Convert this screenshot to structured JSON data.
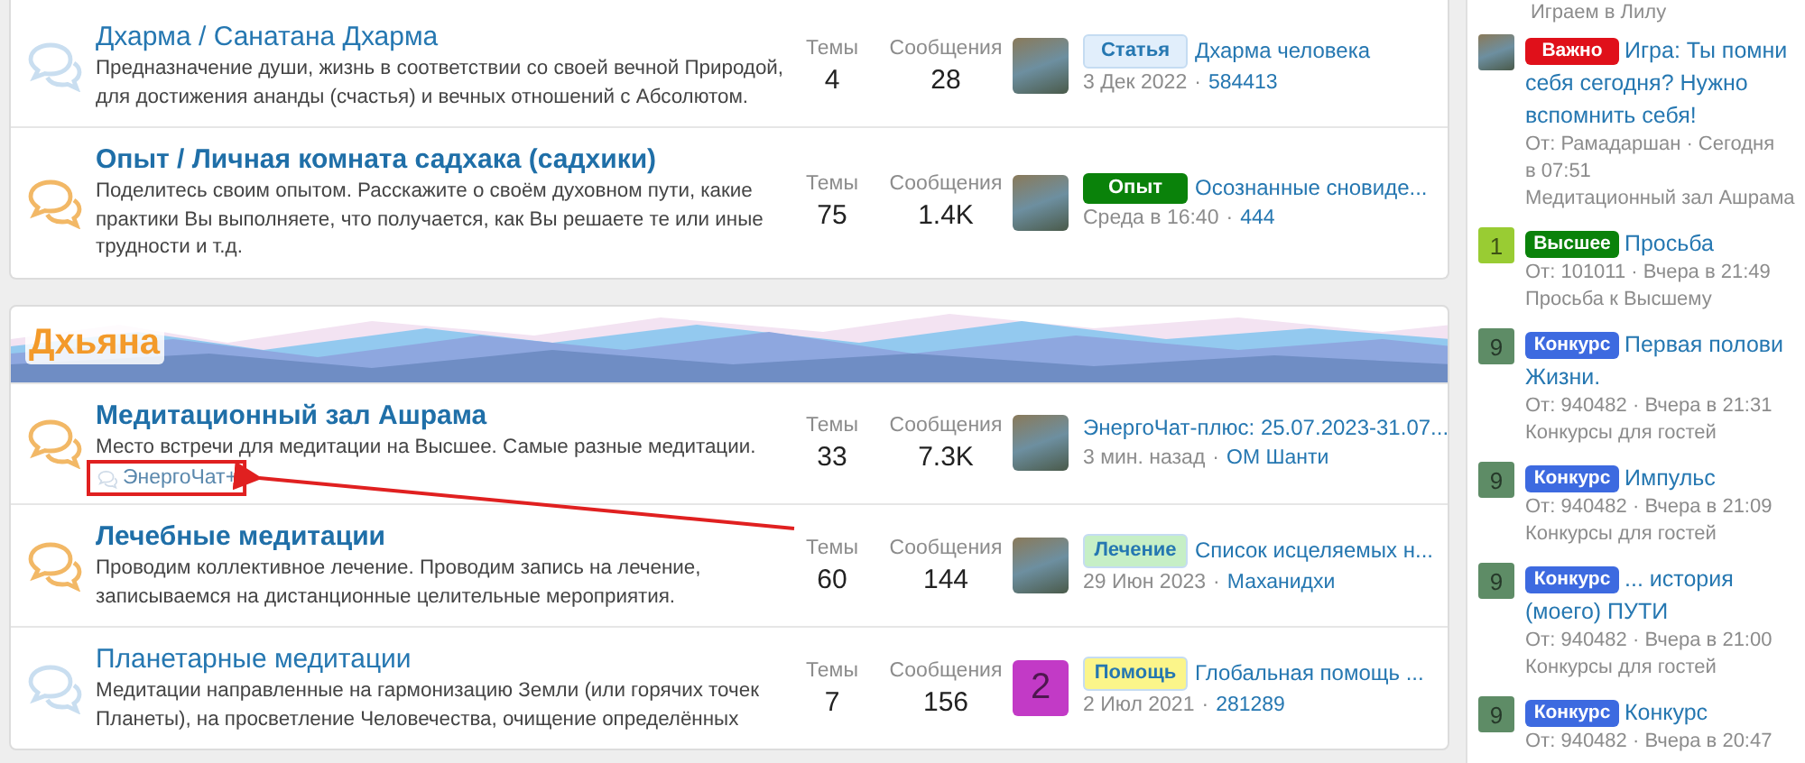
{
  "sections": [
    {
      "nodes": [
        {
          "title": "Дхарма / Санатана Дхарма",
          "unread": false,
          "description": "Предназначение души, жизнь в соответствии со своей вечной Природой, для достижения ананды (счастья) и вечных отношений с Абсолютом.",
          "stats": [
            {
              "label": "Темы",
              "value": "4"
            },
            {
              "label": "Сообщения",
              "value": "28"
            }
          ],
          "last_post": {
            "thumb": {
              "kind": "photo"
            },
            "prefix": {
              "label": "Статья",
              "color": "#e1eefb"
            },
            "title": "Дхарма человека",
            "date": "3 Дек 2022",
            "sep": "·",
            "user": "584413"
          }
        },
        {
          "title": "Опыт / Личная комната садхака (садхики)",
          "unread": true,
          "description": "Поделитесь своим опытом. Расскажите о своём духовном пути, какие практики Вы выполняете, что получается, как Вы решаете те или иные трудности и т.д.",
          "stats": [
            {
              "label": "Темы",
              "value": "75"
            },
            {
              "label": "Сообщения",
              "value": "1.4K"
            }
          ],
          "last_post": {
            "thumb": {
              "kind": "photo"
            },
            "prefix": {
              "label": "Опыт",
              "color": "#0a820a"
            },
            "title": "Осознанные сновиде...",
            "date": "Среда в 16:40",
            "sep": "·",
            "user": "444"
          }
        }
      ]
    },
    {
      "title": "Дхьяна",
      "nodes": [
        {
          "title": "Медитационный зал Ашрама",
          "unread": true,
          "description": "Место встречи для медитации на Высшее. Самые разные медитации.",
          "subforums": [
            {
              "title": "ЭнергоЧат+"
            }
          ],
          "stats": [
            {
              "label": "Темы",
              "value": "33"
            },
            {
              "label": "Сообщения",
              "value": "7.3K"
            }
          ],
          "last_post": {
            "thumb": {
              "kind": "photo"
            },
            "title": "ЭнергоЧат-плюс: 25.07.2023-31.07...",
            "date": "3 мин. назад",
            "sep": "·",
            "user": "ОМ Шанти"
          }
        },
        {
          "title": "Лечебные медитации",
          "unread": true,
          "description": "Проводим коллективное лечение. Проводим запись на лечение, записываемся на дистанционные целительные мероприятия.",
          "stats": [
            {
              "label": "Темы",
              "value": "60"
            },
            {
              "label": "Сообщения",
              "value": "144"
            }
          ],
          "last_post": {
            "thumb": {
              "kind": "photo"
            },
            "prefix": {
              "label": "Лечение",
              "color": "#c6efc6"
            },
            "title": "Список исцеляемых н...",
            "date": "29 Июн 2023",
            "sep": "·",
            "user": "Маханидхи"
          }
        },
        {
          "title": "Планетарные медитации",
          "unread": false,
          "description": "Медитации направленные на гармонизацию Земли (или горячих точек Планеты), на просветление Человечества, очищение определённых",
          "stats": [
            {
              "label": "Темы",
              "value": "7"
            },
            {
              "label": "Сообщения",
              "value": "156"
            }
          ],
          "last_post": {
            "thumb": {
              "kind": "letter",
              "letter": "2",
              "color": "#c23ac6"
            },
            "prefix": {
              "label": "Помощь",
              "color": "#fbf58a"
            },
            "title": "Глобальная помощь ...",
            "date": "2 Июл 2021",
            "sep": "·",
            "user": "281289"
          }
        }
      ]
    }
  ],
  "sidebar": {
    "clipped_forum": "Играем в Лилу",
    "items": [
      {
        "avatar": {
          "kind": "photo"
        },
        "prefix": {
          "label": "Важно",
          "color": "#e0101a"
        },
        "title_lines": [
          "Игра: Ты помни",
          "себя сегодня? Нужно",
          "вспомнить себя!"
        ],
        "meta": "От: Рамадаршан · Сегодня в 07:51",
        "forum": "Медитационный зал Ашрама"
      },
      {
        "avatar": {
          "kind": "letter",
          "letter": "1",
          "color": "#99cc33"
        },
        "prefix": {
          "label": "Высшее",
          "color": "#0a820a"
        },
        "title_lines": [
          "Просьба"
        ],
        "meta": "От: 101011 · Вчера в 21:49",
        "forum": "Просьба к Высшему"
      },
      {
        "avatar": {
          "kind": "letter",
          "letter": "9",
          "color": "#5e8c66"
        },
        "prefix": {
          "label": "Конкурс",
          "color": "#3d6ae0"
        },
        "title_lines": [
          "Первая полови",
          "Жизни."
        ],
        "meta": "От: 940482 · Вчера в 21:31",
        "forum": "Конкурсы для гостей"
      },
      {
        "avatar": {
          "kind": "letter",
          "letter": "9",
          "color": "#5e8c66"
        },
        "prefix": {
          "label": "Конкурс",
          "color": "#3d6ae0"
        },
        "title_lines": [
          "Импульс"
        ],
        "meta": "От: 940482 · Вчера в 21:09",
        "forum": "Конкурсы для гостей"
      },
      {
        "avatar": {
          "kind": "letter",
          "letter": "9",
          "color": "#5e8c66"
        },
        "prefix": {
          "label": "Конкурс",
          "color": "#3d6ae0"
        },
        "title_lines": [
          "... история",
          "(моего) ПУТИ"
        ],
        "meta": "От: 940482 · Вчера в 21:00",
        "forum": "Конкурсы для гостей"
      },
      {
        "avatar": {
          "kind": "letter",
          "letter": "9",
          "color": "#5e8c66"
        },
        "prefix": {
          "label": "Конкурс",
          "color": "#3d6ae0"
        },
        "title_lines": [
          "Конкурс"
        ],
        "meta": "От: 940482 · Вчера в 20:47"
      }
    ]
  }
}
